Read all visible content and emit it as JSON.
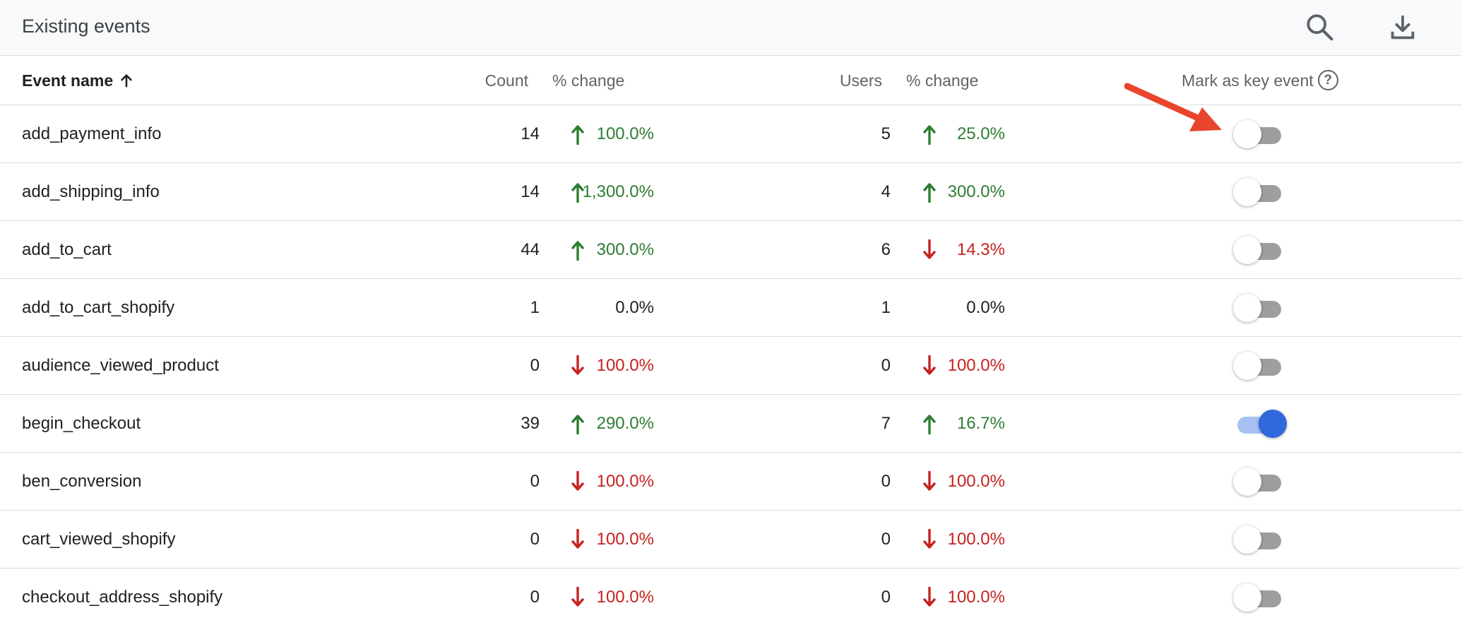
{
  "toolbar": {
    "title": "Existing events",
    "search_icon": "search-icon",
    "download_icon": "download-icon"
  },
  "columns": {
    "event_name": "Event name",
    "count": "Count",
    "change1": "% change",
    "users": "Users",
    "change2": "% change",
    "key_event": "Mark as key event",
    "help": "?"
  },
  "colors": {
    "up": "#2e7d32",
    "down": "#c5221f",
    "toggle_on": "#3168db",
    "annotation_arrow": "#e8452c"
  },
  "rows": [
    {
      "name": "add_payment_info",
      "count": "14",
      "count_change": "100.0%",
      "count_dir": "up",
      "users": "5",
      "users_change": "25.0%",
      "users_dir": "up",
      "key_event": false
    },
    {
      "name": "add_shipping_info",
      "count": "14",
      "count_change": "1,300.0%",
      "count_dir": "up",
      "users": "4",
      "users_change": "300.0%",
      "users_dir": "up",
      "key_event": false
    },
    {
      "name": "add_to_cart",
      "count": "44",
      "count_change": "300.0%",
      "count_dir": "up",
      "users": "6",
      "users_change": "14.3%",
      "users_dir": "down",
      "key_event": false
    },
    {
      "name": "add_to_cart_shopify",
      "count": "1",
      "count_change": "0.0%",
      "count_dir": "flat",
      "users": "1",
      "users_change": "0.0%",
      "users_dir": "flat",
      "key_event": false
    },
    {
      "name": "audience_viewed_product",
      "count": "0",
      "count_change": "100.0%",
      "count_dir": "down",
      "users": "0",
      "users_change": "100.0%",
      "users_dir": "down",
      "key_event": false
    },
    {
      "name": "begin_checkout",
      "count": "39",
      "count_change": "290.0%",
      "count_dir": "up",
      "users": "7",
      "users_change": "16.7%",
      "users_dir": "up",
      "key_event": true
    },
    {
      "name": "ben_conversion",
      "count": "0",
      "count_change": "100.0%",
      "count_dir": "down",
      "users": "0",
      "users_change": "100.0%",
      "users_dir": "down",
      "key_event": false
    },
    {
      "name": "cart_viewed_shopify",
      "count": "0",
      "count_change": "100.0%",
      "count_dir": "down",
      "users": "0",
      "users_change": "100.0%",
      "users_dir": "down",
      "key_event": false
    },
    {
      "name": "checkout_address_shopify",
      "count": "0",
      "count_change": "100.0%",
      "count_dir": "down",
      "users": "0",
      "users_change": "100.0%",
      "users_dir": "down",
      "key_event": false
    }
  ]
}
